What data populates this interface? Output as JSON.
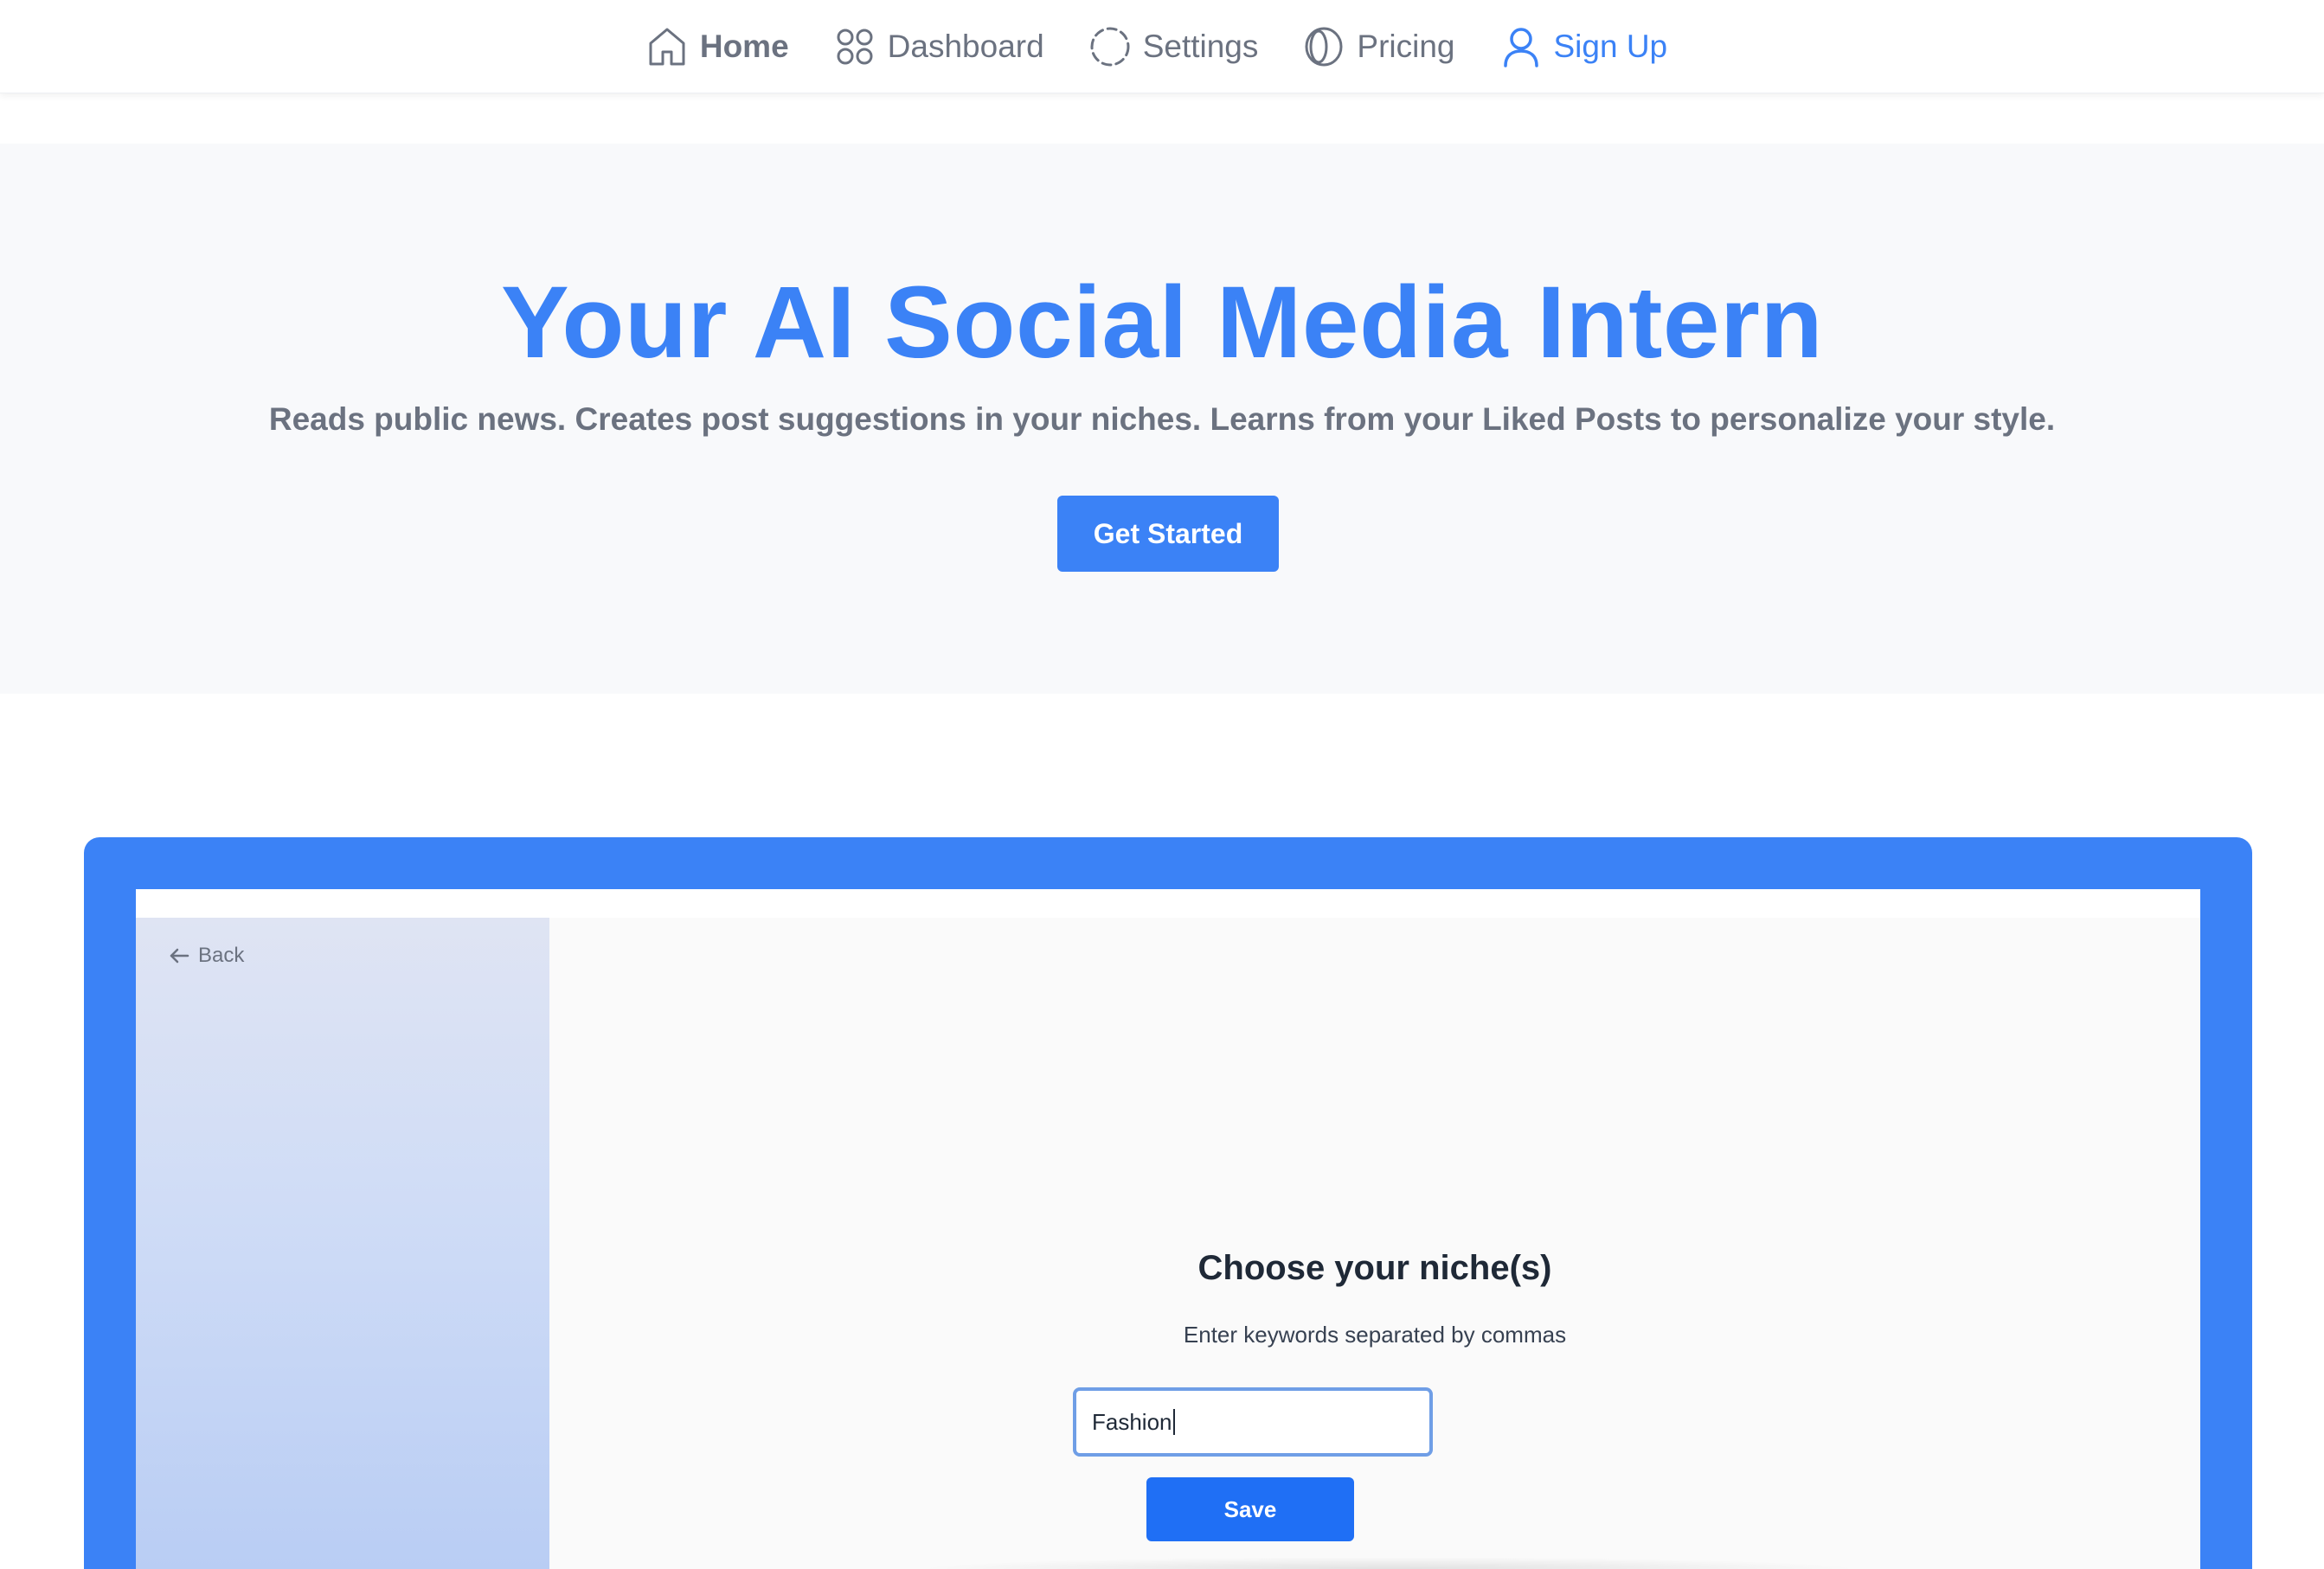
{
  "nav": {
    "items": [
      {
        "label": "Home",
        "icon": "home-icon"
      },
      {
        "label": "Dashboard",
        "icon": "grid-circles-icon"
      },
      {
        "label": "Settings",
        "icon": "dashed-circle-icon"
      },
      {
        "label": "Pricing",
        "icon": "coin-icon"
      },
      {
        "label": "Sign Up",
        "icon": "user-icon"
      }
    ],
    "active": "Home"
  },
  "hero": {
    "title": "Your AI Social Media Intern",
    "subtitle": "Reads public news. Creates post suggestions in your niches. Learns from your Liked Posts to personalize your style.",
    "cta_label": "Get Started"
  },
  "preview": {
    "back_label": "Back",
    "heading": "Choose your niche(s)",
    "hint": "Enter keywords separated by commas",
    "input_value": "Fashion",
    "save_label": "Save"
  },
  "colors": {
    "accent": "#3b82f6",
    "text_muted": "#6b7280",
    "hero_bg": "#f8f9fb",
    "save_button": "#1f6ff5"
  }
}
